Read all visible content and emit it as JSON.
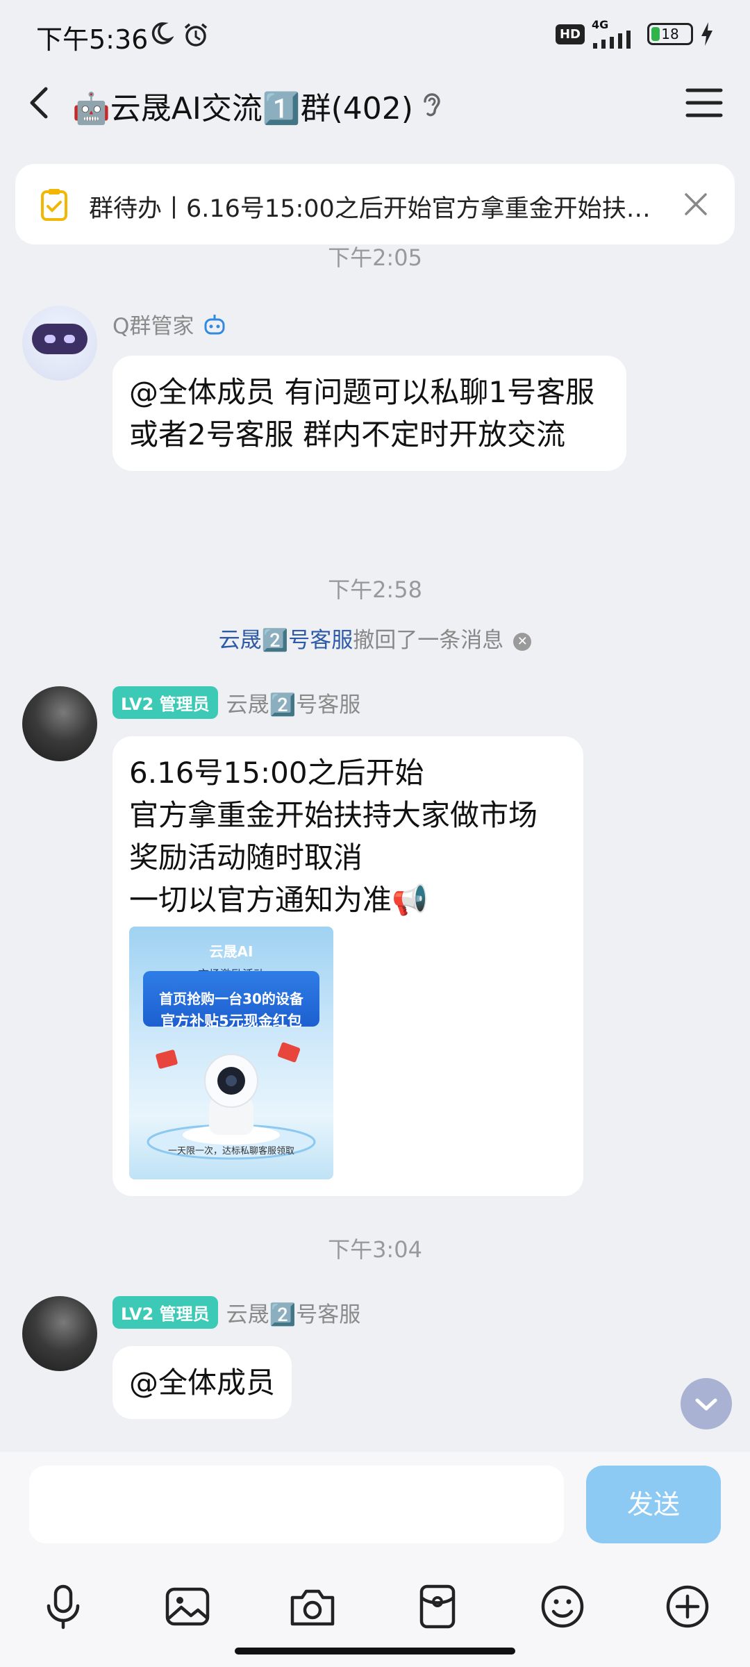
{
  "status_bar": {
    "time": "下午5:36",
    "network": "4G",
    "hd": "HD",
    "battery": "18"
  },
  "header": {
    "title": "🤖云晟AI交流1️⃣群(402)"
  },
  "todo": {
    "text": "群待办丨6.16号15:00之后开始官方拿重金开始扶…"
  },
  "messages": {
    "t1": "下午2:05",
    "bot_name": "Q群管家",
    "bot_text": "@全体成员 有问题可以私聊1号客服或者2号客服 群内不定时开放交流",
    "t2": "下午2:58",
    "recall_name": "云晟2️⃣号客服",
    "recall_text": "撤回了一条消息",
    "admin_badge": "LV2 管理员",
    "sender2": "云晟2️⃣号客服",
    "msg2_l1": "6.16号15:00之后开始",
    "msg2_l2": "官方拿重金开始扶持大家做市场",
    "msg2_l3": "奖励活动随时取消",
    "msg2_l4": "一切以官方通知为准📢",
    "promo_brand": "云晟AI",
    "promo_sub": "市场激励活动",
    "promo_line1": "首页抢购一台30的设备",
    "promo_line2": "官方补贴5元现金红包",
    "promo_foot": "一天限一次，达标私聊客服领取",
    "t3": "下午3:04",
    "sender3": "云晟2️⃣号客服",
    "msg3": "@全体成员"
  },
  "input": {
    "placeholder": "",
    "send_label": "发送"
  },
  "icons": [
    "back-icon",
    "ear-icon",
    "menu-icon",
    "todo-icon",
    "close-icon",
    "robot-icon",
    "chevron-down-icon",
    "mic-icon",
    "image-icon",
    "camera-icon",
    "red-packet-icon",
    "emoji-icon",
    "plus-icon"
  ],
  "colors": {
    "accent": "#8ccaf4",
    "admin_badge": "#3cc9b5",
    "recall_name": "#2d5aa8",
    "background": "#eff0f4"
  }
}
